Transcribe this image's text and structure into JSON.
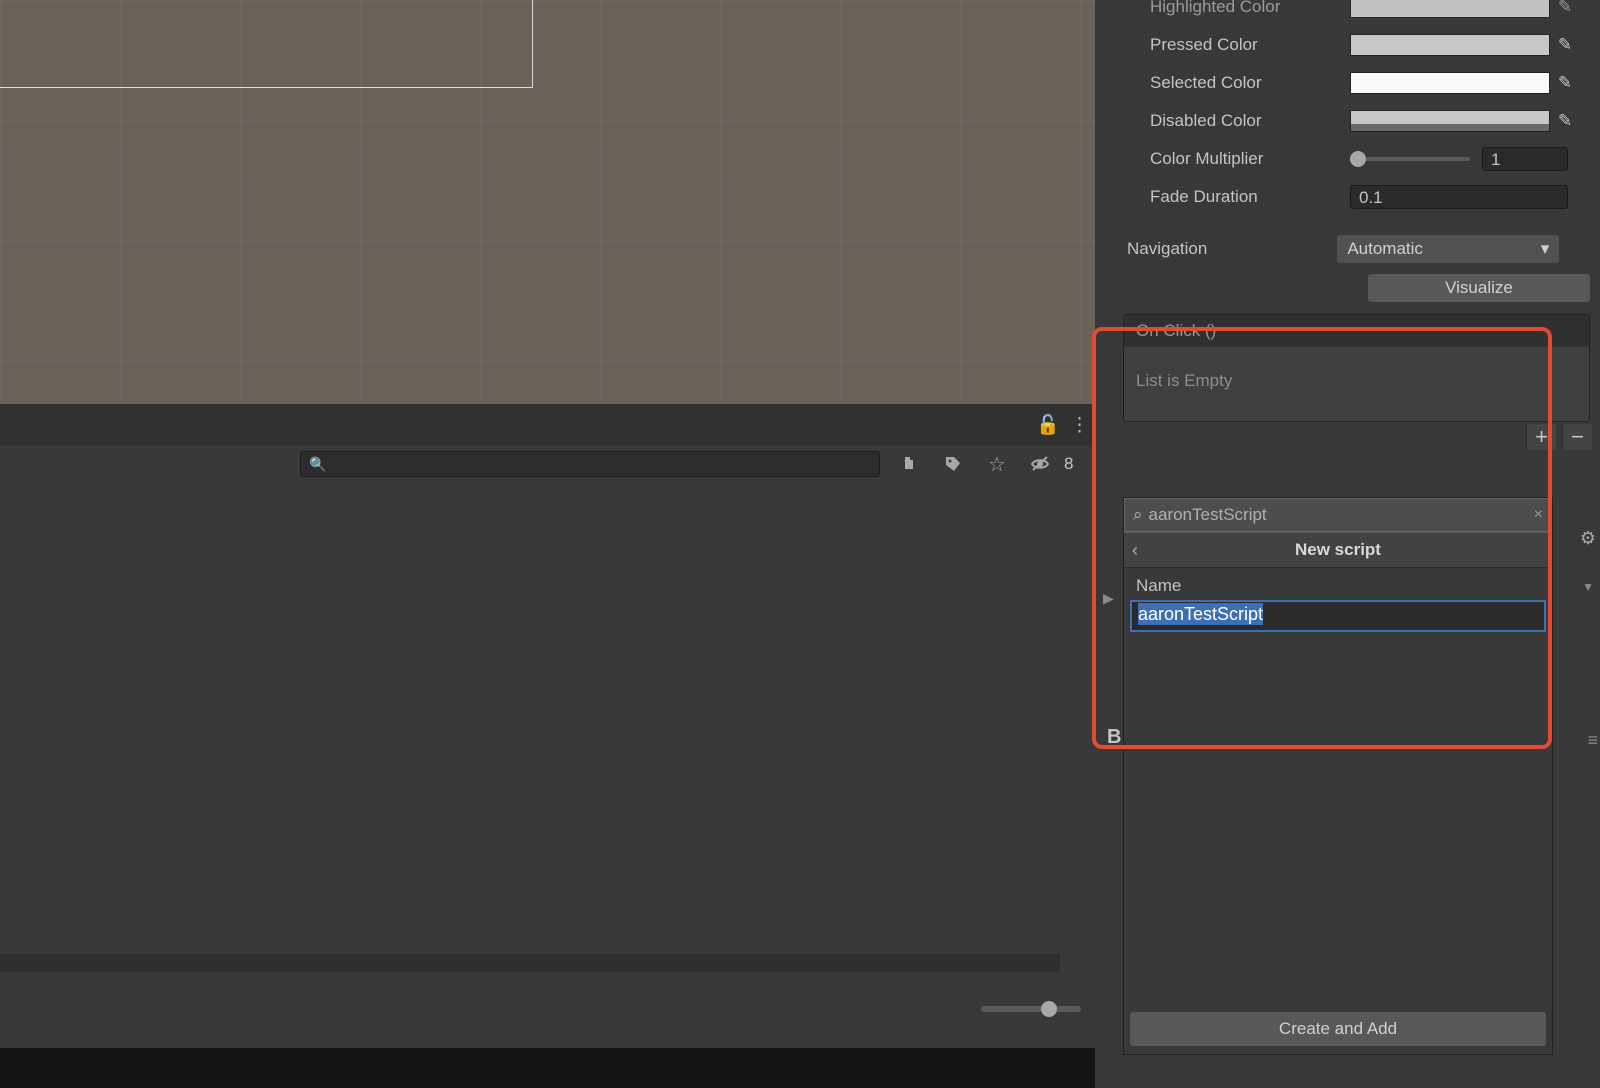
{
  "inspector": {
    "highlighted_color_label": "Highlighted Color",
    "pressed_color_label": "Pressed Color",
    "selected_color_label": "Selected Color",
    "disabled_color_label": "Disabled Color",
    "color_multiplier_label": "Color Multiplier",
    "color_multiplier_value": "1",
    "fade_duration_label": "Fade Duration",
    "fade_duration_value": "0.1",
    "navigation_label": "Navigation",
    "navigation_value": "Automatic",
    "visualize_label": "Visualize",
    "onclick_header": "On Click ()",
    "onclick_empty": "List is Empty",
    "add_icon": "+",
    "remove_icon": "−"
  },
  "popup": {
    "search_value": "aaronTestScript",
    "header_title": "New script",
    "name_label": "Name",
    "name_value": "aaronTestScript",
    "create_btn": "Create and Add",
    "back_icon": "‹",
    "close_icon": "×",
    "search_icon": "🔍"
  },
  "toolbar": {
    "lock_icon": "🔓",
    "more_icon": "⋮",
    "search_icon": "🔍",
    "layers_count": "8"
  },
  "misc": {
    "b_letter": "B",
    "gear_icon": "⚙",
    "tri_icon": "▶",
    "dd_arrow": "▼",
    "drag_handle": "≡"
  }
}
